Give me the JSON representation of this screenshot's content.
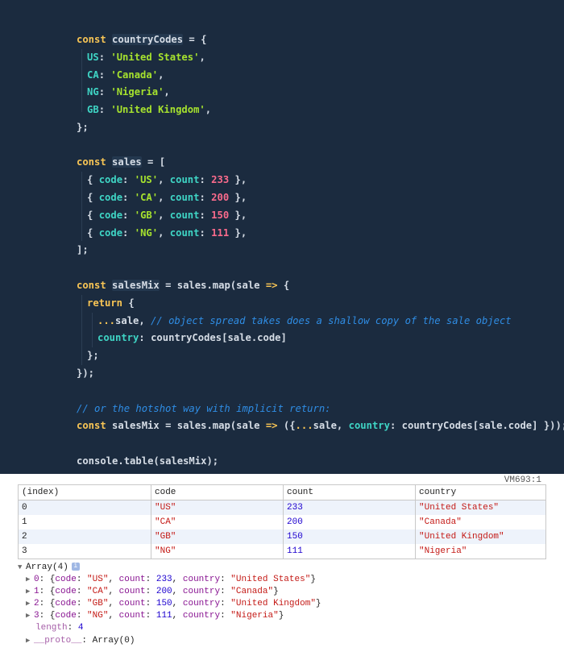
{
  "editor": {
    "lines": [
      [
        [
          "kw",
          "const "
        ],
        [
          "id",
          "countryCodes"
        ],
        [
          "op",
          " = {"
        ]
      ],
      [
        [
          "prop",
          "US"
        ],
        [
          "op",
          ": "
        ],
        [
          "str",
          "'United States'"
        ],
        [
          "op",
          ","
        ]
      ],
      [
        [
          "prop",
          "CA"
        ],
        [
          "op",
          ": "
        ],
        [
          "str",
          "'Canada'"
        ],
        [
          "op",
          ","
        ]
      ],
      [
        [
          "prop",
          "NG"
        ],
        [
          "op",
          ": "
        ],
        [
          "str",
          "'Nigeria'"
        ],
        [
          "op",
          ","
        ]
      ],
      [
        [
          "prop",
          "GB"
        ],
        [
          "op",
          ": "
        ],
        [
          "str",
          "'United Kingdom'"
        ],
        [
          "op",
          ","
        ]
      ],
      [
        [
          "op",
          "};"
        ]
      ],
      [],
      [
        [
          "kw",
          "const "
        ],
        [
          "id",
          "sales"
        ],
        [
          "op",
          " = ["
        ]
      ],
      [
        [
          "op",
          "{ "
        ],
        [
          "prop",
          "code"
        ],
        [
          "op",
          ": "
        ],
        [
          "str",
          "'US'"
        ],
        [
          "op",
          ", "
        ],
        [
          "prop",
          "count"
        ],
        [
          "op",
          ": "
        ],
        [
          "num",
          "233"
        ],
        [
          "op",
          " },"
        ]
      ],
      [
        [
          "op",
          "{ "
        ],
        [
          "prop",
          "code"
        ],
        [
          "op",
          ": "
        ],
        [
          "str",
          "'CA'"
        ],
        [
          "op",
          ", "
        ],
        [
          "prop",
          "count"
        ],
        [
          "op",
          ": "
        ],
        [
          "num",
          "200"
        ],
        [
          "op",
          " },"
        ]
      ],
      [
        [
          "op",
          "{ "
        ],
        [
          "prop",
          "code"
        ],
        [
          "op",
          ": "
        ],
        [
          "str",
          "'GB'"
        ],
        [
          "op",
          ", "
        ],
        [
          "prop",
          "count"
        ],
        [
          "op",
          ": "
        ],
        [
          "num",
          "150"
        ],
        [
          "op",
          " },"
        ]
      ],
      [
        [
          "op",
          "{ "
        ],
        [
          "prop",
          "code"
        ],
        [
          "op",
          ": "
        ],
        [
          "str",
          "'NG'"
        ],
        [
          "op",
          ", "
        ],
        [
          "prop",
          "count"
        ],
        [
          "op",
          ": "
        ],
        [
          "num",
          "111"
        ],
        [
          "op",
          " },"
        ]
      ],
      [
        [
          "op",
          "];"
        ]
      ],
      [],
      [
        [
          "kw",
          "const "
        ],
        [
          "id",
          "salesMix"
        ],
        [
          "op",
          " = "
        ],
        [
          "id",
          "sales"
        ],
        [
          "op",
          "."
        ],
        [
          "fn",
          "map"
        ],
        [
          "op",
          "("
        ],
        [
          "id",
          "sale"
        ],
        [
          "kw",
          " => "
        ],
        [
          "op",
          "{"
        ]
      ],
      [
        [
          "kw",
          "return "
        ],
        [
          "op",
          "{"
        ]
      ],
      [
        [
          "kw",
          "..."
        ],
        [
          "id",
          "sale"
        ],
        [
          "op",
          ", "
        ],
        [
          "cm",
          "// object spread takes does a shallow copy of the sale object"
        ]
      ],
      [
        [
          "prop",
          "country"
        ],
        [
          "op",
          ": "
        ],
        [
          "id",
          "countryCodes"
        ],
        [
          "op",
          "["
        ],
        [
          "id",
          "sale"
        ],
        [
          "op",
          "."
        ],
        [
          "id",
          "code"
        ],
        [
          "op",
          "]"
        ]
      ],
      [
        [
          "op",
          "};"
        ]
      ],
      [
        [
          "op",
          "});"
        ]
      ],
      [],
      [
        [
          "cm",
          "// or the hotshot way with implicit return:"
        ]
      ],
      [
        [
          "kw",
          "const "
        ],
        [
          "id",
          "salesMix"
        ],
        [
          "op",
          " = "
        ],
        [
          "id",
          "sales"
        ],
        [
          "op",
          "."
        ],
        [
          "fn",
          "map"
        ],
        [
          "op",
          "("
        ],
        [
          "id",
          "sale"
        ],
        [
          "kw",
          " => "
        ],
        [
          "op",
          "({"
        ],
        [
          "kw",
          "..."
        ],
        [
          "id",
          "sale"
        ],
        [
          "op",
          ", "
        ],
        [
          "prop",
          "country"
        ],
        [
          "op",
          ": "
        ],
        [
          "id",
          "countryCodes"
        ],
        [
          "op",
          "["
        ],
        [
          "id",
          "sale"
        ],
        [
          "op",
          "."
        ],
        [
          "id",
          "code"
        ],
        [
          "op",
          "] }));"
        ]
      ],
      [],
      [
        [
          "id",
          "console"
        ],
        [
          "op",
          "."
        ],
        [
          "fn",
          "table"
        ],
        [
          "op",
          "("
        ],
        [
          "id",
          "salesMix"
        ],
        [
          "op",
          ");"
        ]
      ]
    ]
  },
  "console": {
    "source_link": "VM693:1",
    "table": {
      "headers": [
        "(index)",
        "code",
        "count",
        "country"
      ],
      "rows": [
        [
          "0",
          "\"US\"",
          "233",
          "\"United States\""
        ],
        [
          "1",
          "\"CA\"",
          "200",
          "\"Canada\""
        ],
        [
          "2",
          "\"GB\"",
          "150",
          "\"United Kingdom\""
        ],
        [
          "3",
          "\"NG\"",
          "111",
          "\"Nigeria\""
        ]
      ]
    },
    "tree": {
      "root_label": "Array(4)",
      "info_icon": "i",
      "items": [
        {
          "index": "0",
          "code": "\"US\"",
          "count": "233",
          "country": "\"United States\""
        },
        {
          "index": "1",
          "code": "\"CA\"",
          "count": "200",
          "country": "\"Canada\""
        },
        {
          "index": "2",
          "code": "\"GB\"",
          "count": "150",
          "country": "\"United Kingdom\""
        },
        {
          "index": "3",
          "code": "\"NG\"",
          "count": "111",
          "country": "\"Nigeria\""
        }
      ],
      "length_key": "length",
      "length_value": "4",
      "proto_key": "__proto__",
      "proto_value": "Array(0)"
    }
  }
}
